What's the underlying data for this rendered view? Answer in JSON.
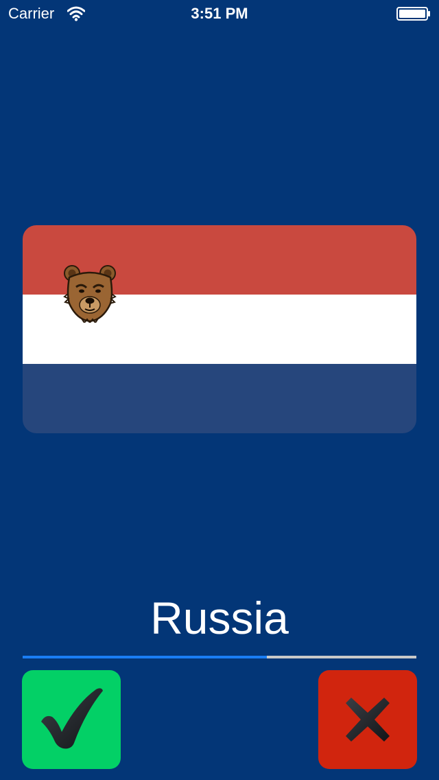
{
  "status_bar": {
    "carrier": "Carrier",
    "time": "3:51 PM",
    "wifi_icon": "wifi-icon",
    "battery_icon": "battery-icon"
  },
  "flag": {
    "stripes": [
      "#c9493f",
      "#ffffff",
      "#26467c"
    ],
    "emblem": "bear-icon"
  },
  "country": {
    "name": "Russia"
  },
  "progress": {
    "value": 0.62,
    "fill_color": "#1a7df4",
    "track_color": "#c9c9c9"
  },
  "buttons": {
    "correct": {
      "icon": "checkmark-icon",
      "color": "#03d066"
    },
    "wrong": {
      "icon": "x-icon",
      "color": "#d1250e"
    }
  },
  "colors": {
    "background": "#033677"
  }
}
